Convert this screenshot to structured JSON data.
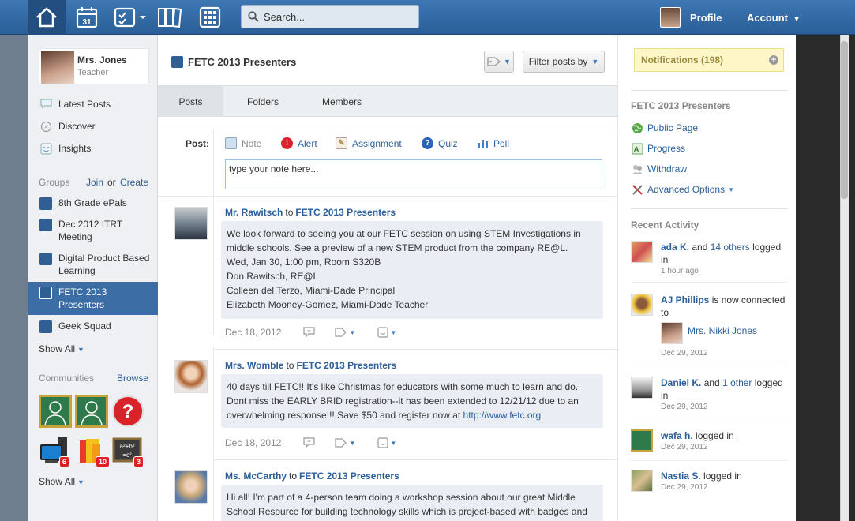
{
  "topbar": {
    "search_placeholder": "Search...",
    "profile_label": "Profile",
    "account_label": "Account",
    "calendar_day": "31"
  },
  "me": {
    "name": "Mrs. Jones",
    "role": "Teacher"
  },
  "nav": [
    {
      "label": "Latest Posts",
      "icon": "speech-bubble-icon"
    },
    {
      "label": "Discover",
      "icon": "compass-icon"
    },
    {
      "label": "Insights",
      "icon": "smiley-icon"
    }
  ],
  "groups": {
    "heading": "Groups",
    "join": "Join",
    "or": "or",
    "create": "Create",
    "items": [
      "8th Grade ePals",
      "Dec 2012 ITRT Meeting",
      "Digital Product Based Learning",
      "FETC 2013 Presenters",
      "Geek Squad"
    ],
    "show_all": "Show All"
  },
  "communities": {
    "heading": "Communities",
    "browse": "Browse",
    "badges": [
      "6",
      "10",
      "3"
    ],
    "show_all": "Show All"
  },
  "main": {
    "group_title": "FETC 2013 Presenters",
    "filter_label": "Filter posts by",
    "tabs": [
      "Posts",
      "Folders",
      "Members"
    ],
    "composer": {
      "post_label": "Post:",
      "types": [
        "Note",
        "Alert",
        "Assignment",
        "Quiz",
        "Poll"
      ],
      "placeholder": "type your note here..."
    },
    "posts": [
      {
        "author": "Mr. Rawitsch",
        "to": "to",
        "group": "FETC 2013 Presenters",
        "lines": [
          "We look forward to seeing you at our FETC session on using STEM Investigations in",
          "middle schools. See a preview of a new STEM product from the company RE@L.",
          "Wed, Jan 30, 1:00 pm, Room S320B",
          "Don Rawitsch, RE@L",
          "Colleen del Terzo, Miami-Dade Principal",
          "Elizabeth Mooney-Gomez, Miami-Dade Teacher"
        ],
        "date": "Dec 18, 2012"
      },
      {
        "author": "Mrs. Womble",
        "to": "to",
        "group": "FETC 2013 Presenters",
        "lines": [
          "40 days till FETC!! It's like Christmas for educators with some much to learn and do.",
          "Dont miss the EARLY BRID registration--it has been extended to 12/21/12 due to an",
          "overwhelming response!!! Save $50 and register now at "
        ],
        "link": "http://www.fetc.org",
        "date": "Dec 18, 2012"
      },
      {
        "author": "Ms. McCarthy",
        "to": "to",
        "group": "FETC 2013 Presenters",
        "lines": [
          "Hi all! I'm part of a 4-person team doing a workshop session about our great Middle",
          "School Resource for building technology skills which is project-based with badges and"
        ]
      }
    ]
  },
  "right": {
    "notifications": "Notifications (198)",
    "group_heading": "FETC 2013 Presenters",
    "links": [
      "Public Page",
      "Progress",
      "Withdraw",
      "Advanced Options"
    ],
    "recent_heading": "Recent Activity",
    "activity": [
      {
        "name": "ada K.",
        "mid": " and ",
        "link": "14 others",
        "rest": " logged in",
        "time": "1 hour ago"
      },
      {
        "name": "AJ Phillips",
        "rest": " is now connected to",
        "sub_name": "Mrs. Nikki Jones",
        "time": "Dec 29, 2012"
      },
      {
        "name": "Daniel K.",
        "mid": " and ",
        "link": "1 other",
        "rest": " logged in",
        "time": "Dec 29, 2012"
      },
      {
        "name": "wafa h.",
        "rest": " logged in",
        "time": "Dec 29, 2012"
      },
      {
        "name": "Nastia S.",
        "rest": " logged in",
        "time": "Dec 29, 2012"
      }
    ]
  }
}
